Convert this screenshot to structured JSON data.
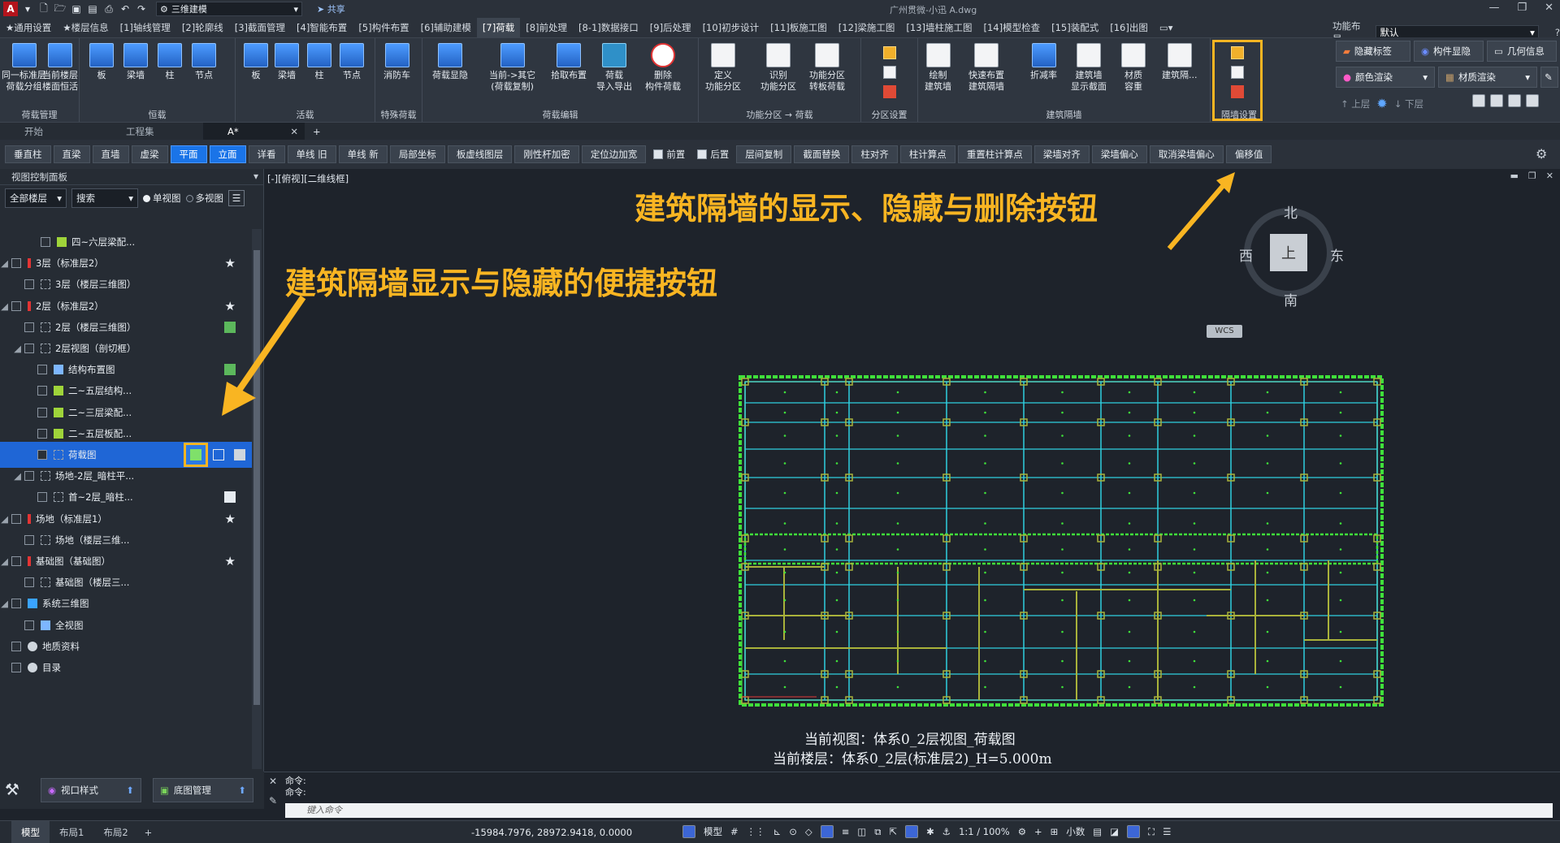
{
  "title_bar": {
    "workspace": "三维建模",
    "share": "共享",
    "center": "广州贯微-小迅    A.dwg",
    "logo": "A"
  },
  "menu": {
    "items": [
      "★通用设置",
      "★楼层信息",
      "[1]轴线管理",
      "[2]轮廓线",
      "[3]截面管理",
      "[4]智能布置",
      "[5]构件布置",
      "[6]辅助建模",
      "[7]荷载",
      "[8]前处理",
      "[8-1]数据接口",
      "[9]后处理",
      "[10]初步设计",
      "[11]板施工图",
      "[12]梁施工图",
      "[13]墙柱施工图",
      "[14]模型检查",
      "[15]装配式",
      "[16]出图"
    ],
    "layout_label": "功能布局:",
    "layout_value": "默认"
  },
  "ribbon": {
    "g1": {
      "b1": "同一标准层",
      "b1b": "荷载分组",
      "b2": "当前楼层",
      "b2b": "楼面恒活",
      "label": "荷载管理"
    },
    "g2": {
      "b1": "板",
      "b2": "梁墙",
      "b3": "柱",
      "b4": "节点",
      "label": "恒载"
    },
    "g3": {
      "b1": "板",
      "b2": "梁墙",
      "b3": "柱",
      "b4": "节点",
      "label": "活载"
    },
    "g4": {
      "b1": "消防车",
      "label": "特殊荷载"
    },
    "g5": {
      "b1": "荷载显隐",
      "b2": "当前->其它",
      "b2b": "(荷载复制)",
      "b3": "拾取布置",
      "b4": "荷载",
      "b4b": "导入导出",
      "b5": "删除",
      "b5b": "构件荷载",
      "label": "荷载编辑"
    },
    "g6": {
      "b1": "定义",
      "b1b": "功能分区",
      "b2": "识别",
      "b2b": "功能分区",
      "b3": "功能分区",
      "b3b": "转板荷载",
      "label": "功能分区 → 荷载"
    },
    "g7": {
      "label": "分区设置"
    },
    "g8": {
      "b1": "绘制",
      "b1b": "建筑墙",
      "b2": "快速布置",
      "b2b": "建筑隔墙",
      "b3": "折减率",
      "b4": "建筑墙",
      "b4b": "显示截面",
      "b5": "材质",
      "b5b": "容重",
      "b6": "建筑隔...",
      "label": "建筑隔墙"
    },
    "g9": {
      "label": "隔墙设置"
    }
  },
  "right_panel": {
    "hide_label": "隐藏标签",
    "comp_show": "构件显隐",
    "geo_info": "几何信息",
    "color_render": "颜色渲染",
    "mat_render": "材质渲染",
    "up": "上层",
    "down": "下层"
  },
  "doc_tabs": [
    "开始",
    "工程集",
    "A*"
  ],
  "toolbar": [
    "垂直柱",
    "直梁",
    "直墙",
    "虚梁",
    "平面",
    "立面",
    "详看",
    "单线 旧",
    "单线 新",
    "局部坐标",
    "板虚线图层",
    "刚性杆加密",
    "定位边加宽",
    "前置",
    "后置",
    "层间复制",
    "截面替换",
    "柱对齐",
    "柱计算点",
    "重置柱计算点",
    "梁墙对齐",
    "梁墙偏心",
    "取消梁墙偏心",
    "偏移值"
  ],
  "panel": {
    "title": "视图控制面板",
    "floor_filter": "全部楼层",
    "search": "搜索",
    "single": "单视图",
    "multi": "多视图",
    "tree": [
      "四~六层梁配...",
      "3层（标准层2）",
      "3层（楼层三维图）",
      "2层（标准层2）",
      "2层（楼层三维图）",
      "2层视图（剖切框）",
      "结构布置图",
      "二~五层结构...",
      "二~三层梁配...",
      "二~五层板配...",
      "荷载图",
      "场地-2层_暗柱平...",
      "首~2层_暗柱...",
      "场地（标准层1）",
      "场地（楼层三维...",
      "基础图（基础图）",
      "基础图（楼层三...",
      "系统三维图",
      "全视图",
      "地质资料",
      "目录"
    ],
    "view_style": "视口样式",
    "base_mgmt": "底图管理"
  },
  "canvas": {
    "view_label": "[-][俯视][二维线框]",
    "callout_top": "建筑隔墙的显示、隐藏与删除按钮",
    "callout_left": "建筑隔墙显示与隐藏的便捷按钮",
    "compass": {
      "n": "北",
      "s": "南",
      "e": "东",
      "w": "西",
      "top": "上",
      "wcs": "WCS"
    },
    "info1": "当前视图：体系0_2层视图_荷载图",
    "info2": "当前楼层：体系0_2层(标准层2)_H=5.000m"
  },
  "command": {
    "line1": "命令:",
    "line2": "命令:",
    "placeholder": "键入命令"
  },
  "status": {
    "tabs": [
      "模型",
      "布局1",
      "布局2"
    ],
    "coords": "-15984.7976, 28972.9418, 0.0000",
    "model": "模型",
    "scale": "1:1 / 100%",
    "units": "小数"
  },
  "colors": {
    "accent": "#1f66d6",
    "callout": "#f9b522",
    "plan_green": "#3fe03a",
    "plan_cyan": "#2fd0e0",
    "plan_olive": "#a9b23a"
  }
}
